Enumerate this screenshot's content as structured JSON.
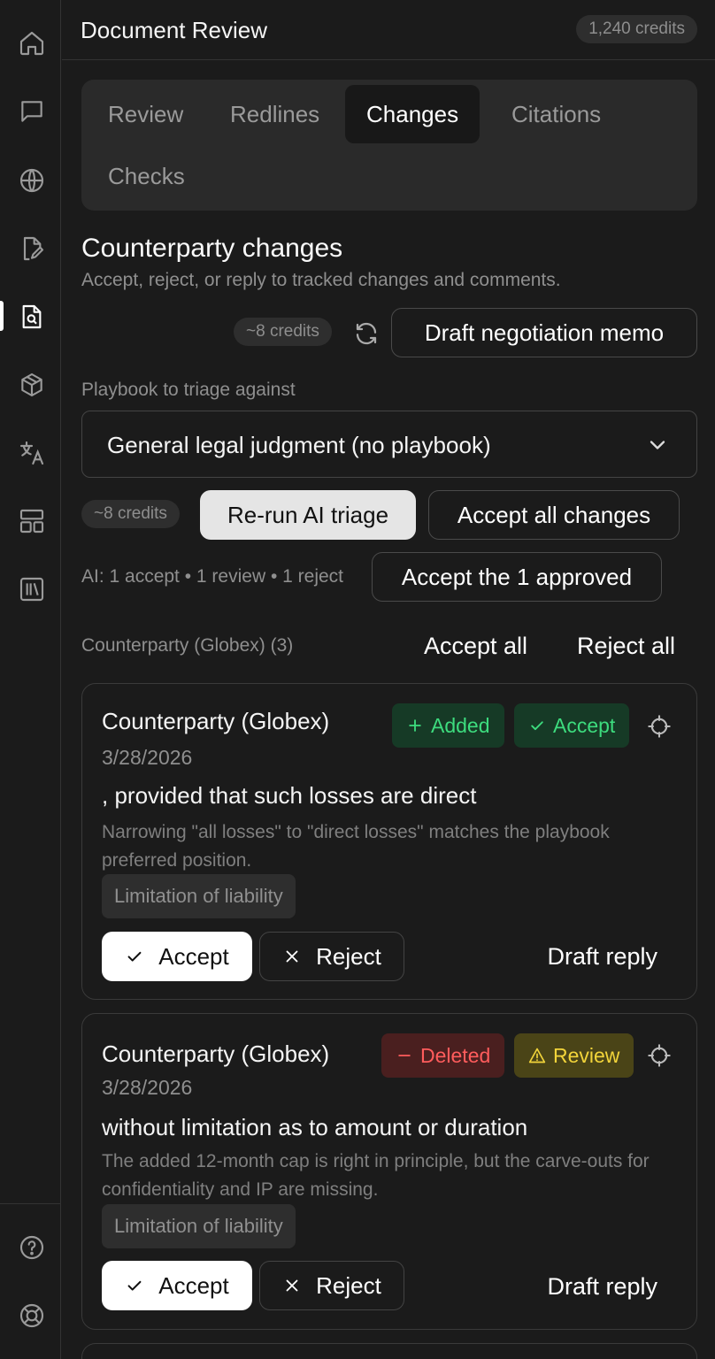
{
  "header": {
    "title": "Document Review",
    "credits": "1,240 credits"
  },
  "tabs": [
    "Review",
    "Redlines",
    "Changes",
    "Citations",
    "Checks"
  ],
  "section": {
    "title": "Counterparty changes",
    "subtitle": "Accept, reject, or reply to tracked changes and comments.",
    "memo_credits": "~8 credits",
    "memo_button": "Draft negotiation memo",
    "playbook_label": "Playbook to triage against",
    "playbook_value": "General legal judgment (no playbook)",
    "triage_credits": "~8 credits",
    "rerun_button": "Re-run AI triage",
    "accept_all_changes": "Accept all changes",
    "ai_summary": "AI: 1 accept • 1 review • 1 reject",
    "accept_approved": "Accept the 1 approved",
    "group_label": "Counterparty (Globex) (3)",
    "accept_all": "Accept all",
    "reject_all": "Reject all"
  },
  "cards": [
    {
      "author": "Counterparty (Globex)",
      "date": "3/28/2026",
      "change_badge": "Added",
      "ai_badge": "Accept",
      "text": ", provided that such losses are direct",
      "reason": "Narrowing \"all losses\" to \"direct losses\" matches the playbook preferred position.",
      "tag": "Limitation of liability",
      "accept": "Accept",
      "reject": "Reject",
      "draft": "Draft reply"
    },
    {
      "author": "Counterparty (Globex)",
      "date": "3/28/2026",
      "change_badge": "Deleted",
      "ai_badge": "Review",
      "text": "without limitation as to amount or duration",
      "reason": "The added 12-month cap is right in principle, but the carve-outs for confidentiality and IP are missing.",
      "tag": "Limitation of liability",
      "accept": "Accept",
      "reject": "Reject",
      "draft": "Draft reply"
    }
  ],
  "rail_icons": [
    "home-icon",
    "chat-icon",
    "globe-icon",
    "file-edit-icon",
    "file-search-icon",
    "box-icon",
    "translate-icon",
    "layout-icon",
    "library-icon",
    "help-icon",
    "lifebuoy-icon"
  ]
}
